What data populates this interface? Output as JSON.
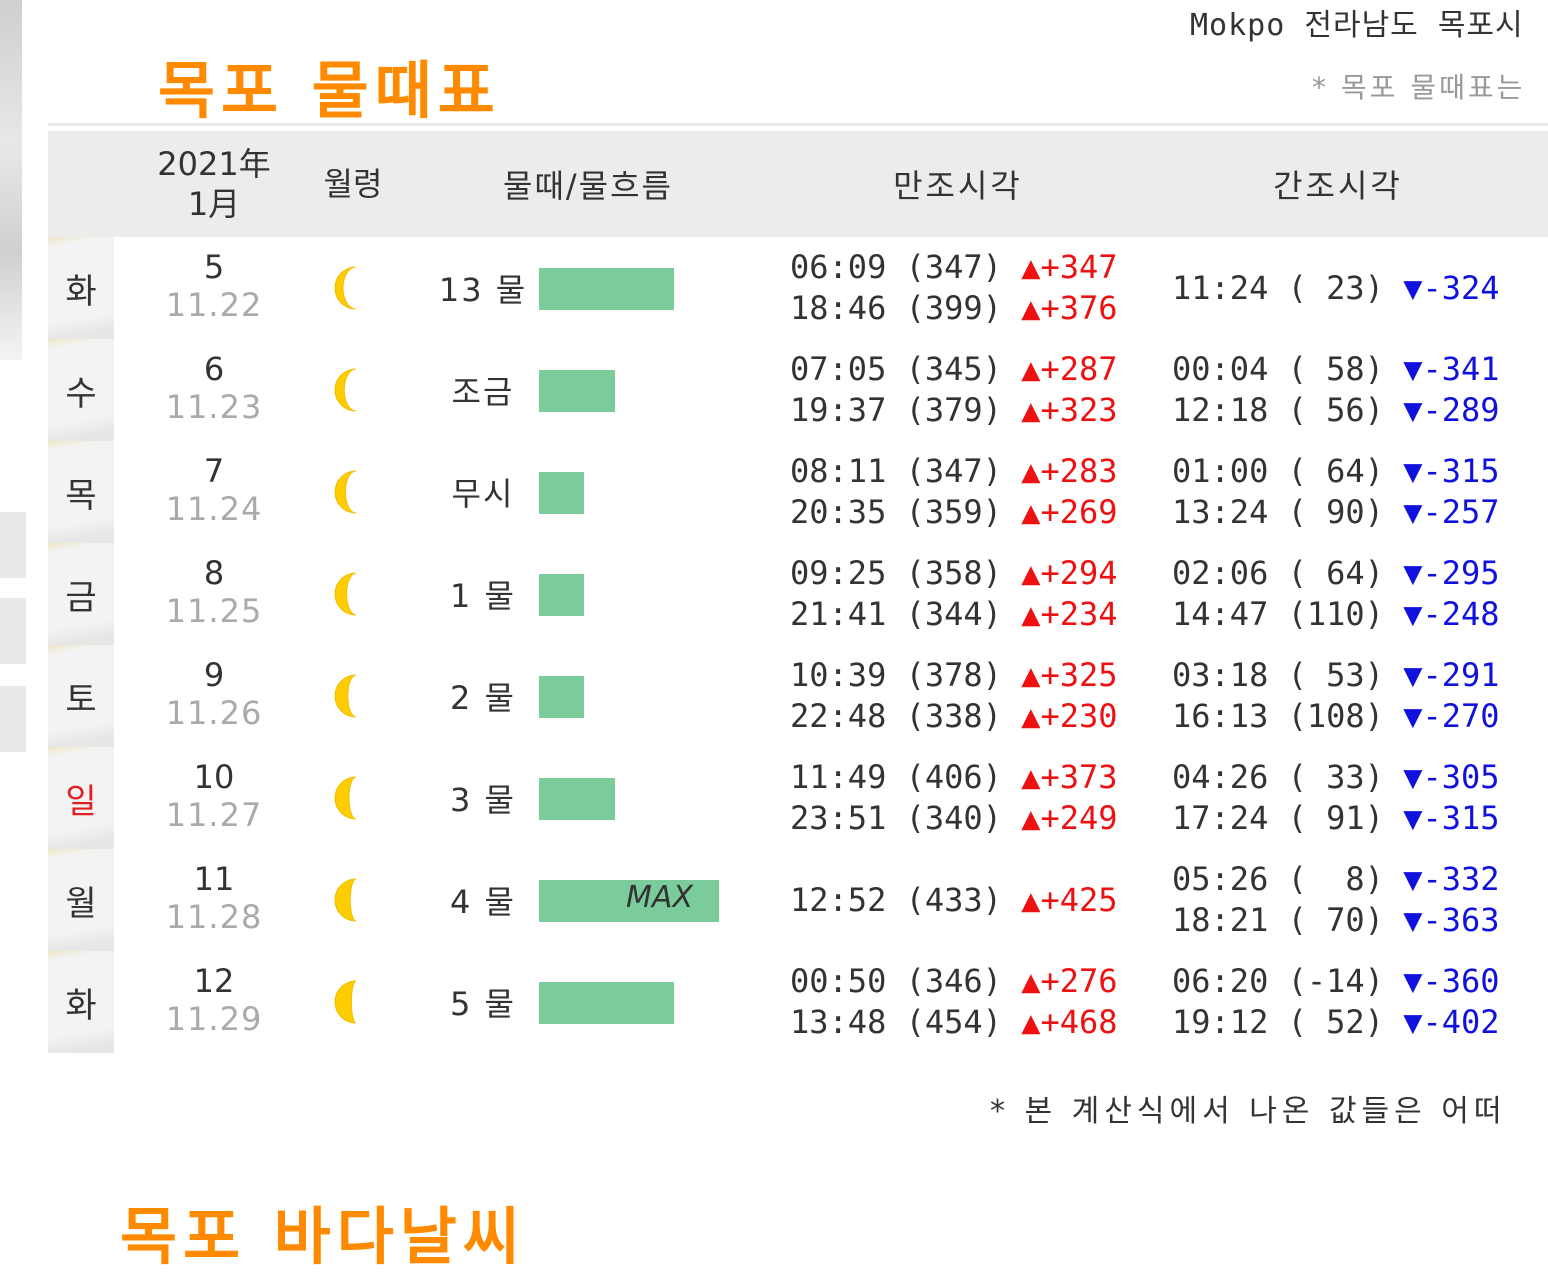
{
  "header": {
    "location": "Mokpo 전라남도 목포시",
    "title": "목포 물때표",
    "note": "* 목포 물때표는"
  },
  "table": {
    "headers": {
      "year": "2021年",
      "month": "1月",
      "moon": "월령",
      "tide": "물때/물흐름",
      "high": "만조시각",
      "low": "간조시각"
    },
    "rows": [
      {
        "dow": "화",
        "day": "5",
        "lunar": "11.22",
        "tide": "13 물",
        "flow": 0.75,
        "max": "",
        "high": [
          "06:09 (347) ",
          "18:46 (399) "
        ],
        "high_d": [
          "▲+347",
          "▲+376"
        ],
        "low": [
          "11:24 ( 23) "
        ],
        "low_d": [
          "▼-324"
        ]
      },
      {
        "dow": "수",
        "day": "6",
        "lunar": "11.23",
        "tide": "조금",
        "flow": 0.42,
        "max": "",
        "high": [
          "07:05 (345) ",
          "19:37 (379) "
        ],
        "high_d": [
          "▲+287",
          "▲+323"
        ],
        "low": [
          "00:04 ( 58) ",
          "12:18 ( 56) "
        ],
        "low_d": [
          "▼-341",
          "▼-289"
        ]
      },
      {
        "dow": "목",
        "day": "7",
        "lunar": "11.24",
        "tide": "무시",
        "flow": 0.25,
        "max": "",
        "high": [
          "08:11 (347) ",
          "20:35 (359) "
        ],
        "high_d": [
          "▲+283",
          "▲+269"
        ],
        "low": [
          "01:00 ( 64) ",
          "13:24 ( 90) "
        ],
        "low_d": [
          "▼-315",
          "▼-257"
        ]
      },
      {
        "dow": "금",
        "day": "8",
        "lunar": "11.25",
        "tide": "1 물",
        "flow": 0.25,
        "max": "",
        "high": [
          "09:25 (358) ",
          "21:41 (344) "
        ],
        "high_d": [
          "▲+294",
          "▲+234"
        ],
        "low": [
          "02:06 ( 64) ",
          "14:47 (110) "
        ],
        "low_d": [
          "▼-295",
          "▼-248"
        ]
      },
      {
        "dow": "토",
        "day": "9",
        "lunar": "11.26",
        "tide": "2 물",
        "flow": 0.25,
        "max": "",
        "high": [
          "10:39 (378) ",
          "22:48 (338) "
        ],
        "high_d": [
          "▲+325",
          "▲+230"
        ],
        "low": [
          "03:18 ( 53) ",
          "16:13 (108) "
        ],
        "low_d": [
          "▼-291",
          "▼-270"
        ]
      },
      {
        "dow": "일",
        "day": "10",
        "lunar": "11.27",
        "tide": "3 물",
        "flow": 0.42,
        "max": "",
        "high": [
          "11:49 (406) ",
          "23:51 (340) "
        ],
        "high_d": [
          "▲+373",
          "▲+249"
        ],
        "low": [
          "04:26 ( 33) ",
          "17:24 ( 91) "
        ],
        "low_d": [
          "▼-305",
          "▼-315"
        ],
        "sunday": true
      },
      {
        "dow": "월",
        "day": "11",
        "lunar": "11.28",
        "tide": "4 물",
        "flow": 1.0,
        "max": "MAX",
        "high": [
          "12:52 (433) "
        ],
        "high_d": [
          "▲+425"
        ],
        "low": [
          "05:26 (  8) ",
          "18:21 ( 70) "
        ],
        "low_d": [
          "▼-332",
          "▼-363"
        ]
      },
      {
        "dow": "화",
        "day": "12",
        "lunar": "11.29",
        "tide": "5 물",
        "flow": 0.75,
        "max": "",
        "high": [
          "00:50 (346) ",
          "13:48 (454) "
        ],
        "high_d": [
          "▲+276",
          "▲+468"
        ],
        "low": [
          "06:20 (-14) ",
          "19:12 ( 52) "
        ],
        "low_d": [
          "▼-360",
          "▼-402"
        ]
      }
    ]
  },
  "footer": {
    "note": "* 본 계산식에서 나온 값들은 어떠",
    "next_title": "목포 바다날씨"
  },
  "colors": {
    "accent": "#ff8a00",
    "bar": "#7acc9b",
    "up": "#ee1111",
    "down": "#1111dd",
    "moon": "#ffcc00"
  }
}
